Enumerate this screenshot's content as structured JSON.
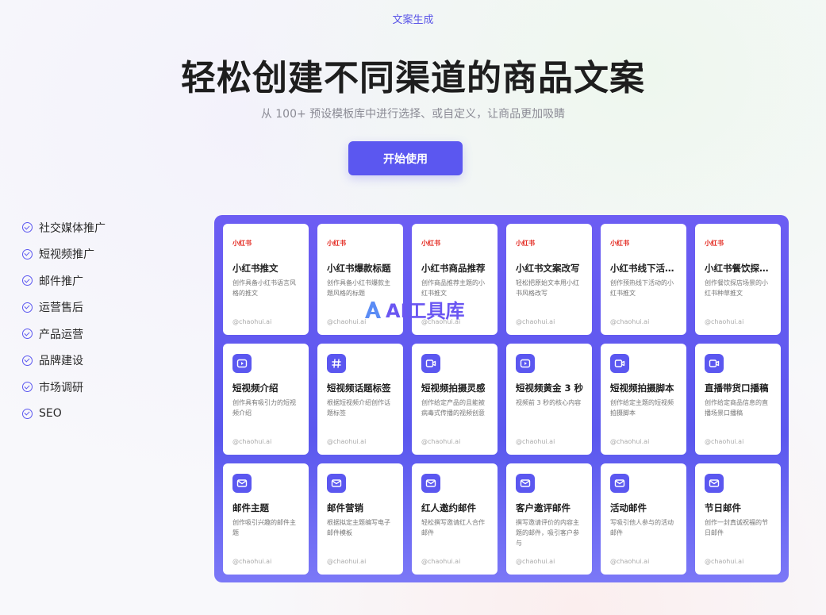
{
  "hero": {
    "eyebrow": "文案生成",
    "title": "轻松创建不同渠道的商品文案",
    "subtitle": "从 100+ 预设模板库中进行选择、或自定义，让商品更加吸睛",
    "cta_label": "开始使用"
  },
  "sidebar": {
    "items": [
      {
        "label": "社交媒体推广"
      },
      {
        "label": "短视频推广"
      },
      {
        "label": "邮件推广"
      },
      {
        "label": "运营售后"
      },
      {
        "label": "产品运营"
      },
      {
        "label": "品牌建设"
      },
      {
        "label": "市场调研"
      },
      {
        "label": "SEO"
      }
    ]
  },
  "brand_logo_text": "小红书",
  "watermark": "AI工具库",
  "accent_color": "#5b57f0",
  "cards": [
    {
      "icon": "xiaohongshu-logo",
      "title": "小红书推文",
      "desc": "创作具备小红书语言风格的推文",
      "foot": "@chaohui.ai"
    },
    {
      "icon": "xiaohongshu-logo",
      "title": "小红书爆款标题",
      "desc": "创作具备小红书爆款主题风格的标题",
      "foot": "@chaohui.ai"
    },
    {
      "icon": "xiaohongshu-logo",
      "title": "小红书商品推荐",
      "desc": "创作商品推荐主题的小红书推文",
      "foot": "@chaohui.ai"
    },
    {
      "icon": "xiaohongshu-logo",
      "title": "小红书文案改写",
      "desc": "轻松把原始文本用小红书风格改写",
      "foot": "@chaohui.ai"
    },
    {
      "icon": "xiaohongshu-logo",
      "title": "小红书线下活动...",
      "desc": "创作预热线下活动的小红书推文",
      "foot": "@chaohui.ai"
    },
    {
      "icon": "xiaohongshu-logo",
      "title": "小红书餐饮探店...",
      "desc": "创作餐饮探店场景的小红书种草推文",
      "foot": "@chaohui.ai"
    },
    {
      "icon": "play-icon",
      "title": "短视频介绍",
      "desc": "创作具有吸引力的短视频介绍",
      "foot": "@chaohui.ai"
    },
    {
      "icon": "hashtag-icon",
      "title": "短视频话题标签",
      "desc": "根据短视频介绍创作话题标签",
      "foot": "@chaohui.ai"
    },
    {
      "icon": "video-camera-icon",
      "title": "短视频拍摄灵感",
      "desc": "创作给定产品的且能被病毒式传播的视频创意",
      "foot": "@chaohui.ai"
    },
    {
      "icon": "play-icon",
      "title": "短视频黄金 3 秒",
      "desc": "视频前 3 秒的核心内容",
      "foot": "@chaohui.ai"
    },
    {
      "icon": "video-camera-icon",
      "title": "短视频拍摄脚本",
      "desc": "创作给定主题的短视频拍摄脚本",
      "foot": "@chaohui.ai"
    },
    {
      "icon": "video-camera-icon",
      "title": "直播带货口播稿",
      "desc": "创作给定商品信息的直播场景口播稿",
      "foot": "@chaohui.ai"
    },
    {
      "icon": "mail-icon",
      "title": "邮件主题",
      "desc": "创作吸引兴趣的邮件主题",
      "foot": "@chaohui.ai"
    },
    {
      "icon": "mail-icon",
      "title": "邮件营销",
      "desc": "根据拟定主题编写电子邮件模板",
      "foot": "@chaohui.ai"
    },
    {
      "icon": "mail-icon",
      "title": "红人邀约邮件",
      "desc": "轻松撰写邀请红人合作邮件",
      "foot": "@chaohui.ai"
    },
    {
      "icon": "mail-icon",
      "title": "客户邀评邮件",
      "desc": "撰写邀请评价的内容主题的邮件，吸引客户参与",
      "foot": "@chaohui.ai"
    },
    {
      "icon": "mail-icon",
      "title": "活动邮件",
      "desc": "写吸引他人参与的活动邮件",
      "foot": "@chaohui.ai"
    },
    {
      "icon": "mail-icon",
      "title": "节日邮件",
      "desc": "创作一封真诚祝福的节日邮件",
      "foot": "@chaohui.ai"
    }
  ]
}
